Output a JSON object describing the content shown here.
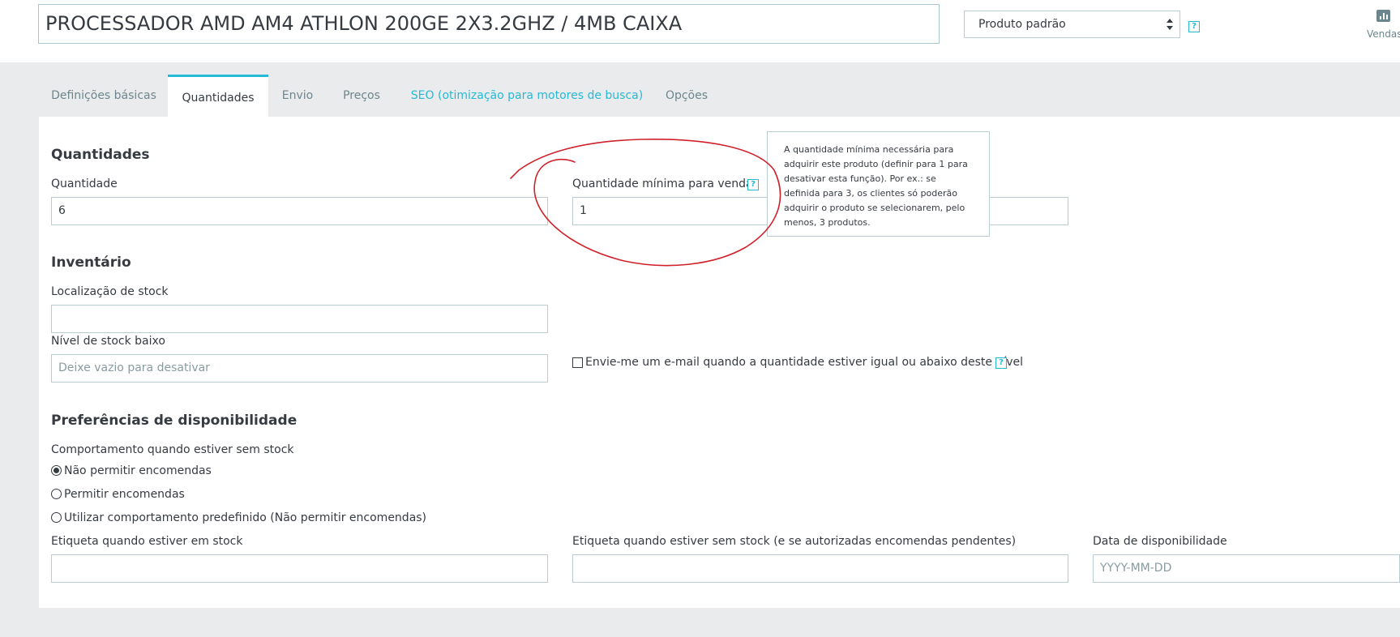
{
  "header": {
    "product_name": "PROCESSADOR AMD AM4 ATHLON 200GE 2X3.2GHZ / 4MB CAIXA",
    "product_type": "Produto padrão",
    "help_symbol": "?",
    "sales_label": "Vendas"
  },
  "tabs": [
    {
      "label": "Definições básicas",
      "active": false
    },
    {
      "label": "Quantidades",
      "active": true
    },
    {
      "label": "Envio",
      "active": false
    },
    {
      "label": "Preços",
      "active": false
    },
    {
      "label": "SEO (otimização para motores de busca)",
      "active": false
    },
    {
      "label": "Opções",
      "active": false
    }
  ],
  "quantities": {
    "title": "Quantidades",
    "quantity_label": "Quantidade",
    "quantity_value": "6",
    "min_qty_label": "Quantidade mínima para venda",
    "min_qty_value": "1",
    "tooltip_lines": [
      "A quantidade mínima necessária para",
      "adquirir este produto (definir para 1 para",
      "desativar esta função). Por ex.: se",
      "definida para 3, os clientes só poderão",
      "adquirir o produto se selecionarem, pelo",
      "menos, 3 produtos."
    ]
  },
  "inventory": {
    "title": "Inventário",
    "location_label": "Localização de stock",
    "location_value": "",
    "low_stock_label": "Nível de stock baixo",
    "low_stock_placeholder": "Deixe vazio para desativar",
    "email_checkbox_label": "Envie-me um e-mail quando a quantidade estiver igual ou abaixo deste nível"
  },
  "availability": {
    "title": "Preferências de disponibilidade",
    "behavior_label": "Comportamento quando estiver sem stock",
    "options": [
      {
        "label": "Não permitir encomendas",
        "checked": true
      },
      {
        "label": "Permitir encomendas",
        "checked": false
      },
      {
        "label": "Utilizar comportamento predefinido (Não permitir encomendas)",
        "checked": false
      }
    ],
    "in_stock_label": "Etiqueta quando estiver em stock",
    "out_stock_label": "Etiqueta quando estiver sem stock (e se autorizadas encomendas pendentes)",
    "date_label": "Data de disponibilidade",
    "date_placeholder": "YYYY-MM-DD"
  },
  "colors": {
    "accent": "#25b9d7",
    "annotation": "#d0212a",
    "background": "#eaebec",
    "text": "#363a41",
    "muted": "#6c868e"
  },
  "icons": {
    "help": "question-square-icon",
    "sales": "bar-chart-icon",
    "select": "select-arrows-icon"
  }
}
